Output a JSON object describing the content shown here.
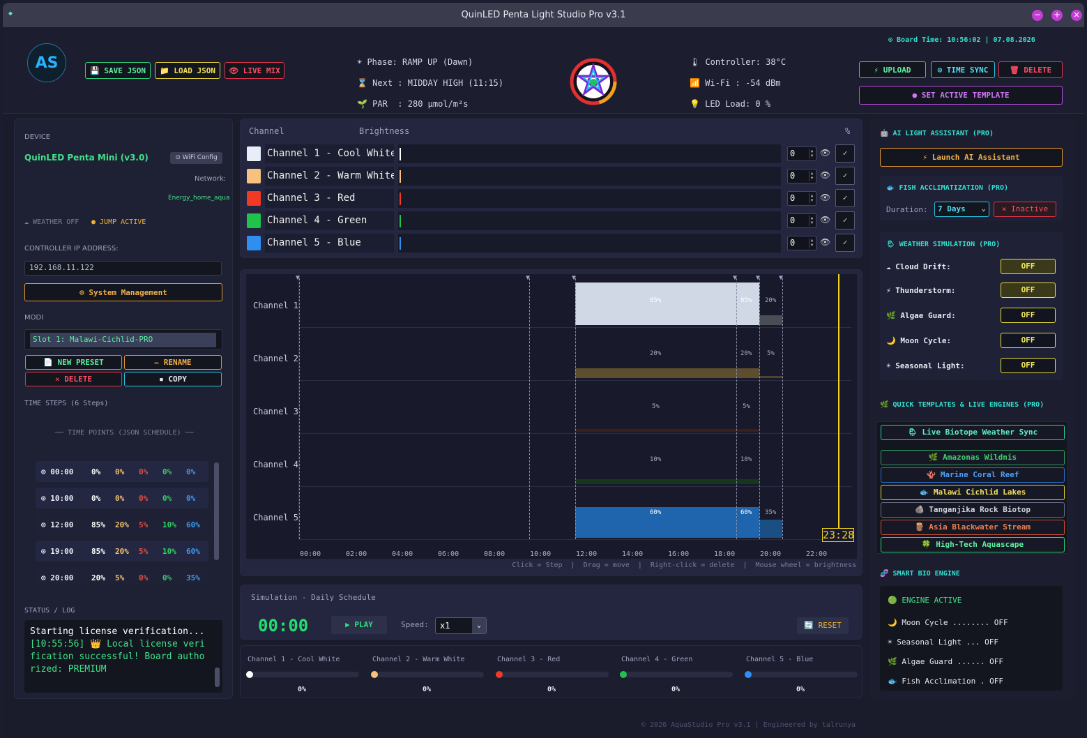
{
  "window": {
    "title": "QuinLED Penta Light Studio Pro v3.1"
  },
  "header": {
    "board_time": "⊙ Board Time: 10:56:02 | 07.08.2026",
    "logo": "AS",
    "save_json": "💾 SAVE JSON",
    "load_json": "📁 LOAD JSON",
    "live_mix": "👁 LIVE MIX",
    "phase": "☀ Phase: RAMP UP (Dawn)",
    "next": "⌛ Next : MIDDAY HIGH (11:15)",
    "par": "🌱 PAR  : 280 μmol/m²s",
    "controller": "🌡 Controller: 38°C",
    "wifi": "📶 Wi-Fi : -54 dBm",
    "led_load": "💡 LED Load: 0 %",
    "upload": "⚡ UPLOAD",
    "time_sync": "⊙ TIME SYNC",
    "delete": "🗑 DELETE",
    "set_active_template": "● SET ACTIVE TEMPLATE"
  },
  "left": {
    "device_label": "DEVICE",
    "device_name": "QuinLED Penta Mini (v3.0)",
    "wifi_config": "⊙ WiFi Config",
    "network_label": "Network:",
    "network_name": "Energy_home_aqua",
    "weather_off": "☁ WEATHER OFF",
    "jump_active": "● JUMP ACTIVE",
    "ip_label": "CONTROLLER IP ADDRESS:",
    "ip_value": "192.168.11.122",
    "system_management": "⊙ System Management",
    "modi_label": "MODI",
    "slot": "Slot 1: Malawi-Cichlid-PRO",
    "new_preset": "📄 NEW PRESET",
    "rename": "✏ RENAME",
    "delete": "✕ DELETE",
    "copy": "▪ COPY",
    "time_steps": "TIME STEPS (6 Steps)",
    "time_points_title": "── TIME POINTS (JSON SCHEDULE) ──",
    "time_points": [
      {
        "t": "⊙ 00:00",
        "v": [
          "0%",
          "0%",
          "0%",
          "0%",
          "0%"
        ]
      },
      {
        "t": "⊙ 10:00",
        "v": [
          "0%",
          "0%",
          "0%",
          "0%",
          "0%"
        ]
      },
      {
        "t": "⊙ 12:00",
        "v": [
          "85%",
          "20%",
          "5%",
          "10%",
          "60%"
        ]
      },
      {
        "t": "⊙ 19:00",
        "v": [
          "85%",
          "20%",
          "5%",
          "10%",
          "60%"
        ]
      },
      {
        "t": "⊙ 20:00",
        "v": [
          "20%",
          "5%",
          "0%",
          "0%",
          "35%"
        ]
      }
    ],
    "status_label": "STATUS / LOG",
    "log1": "Starting license verification...",
    "log2": "[10:55:56] 👑 Local license verification successful! Board authorized: PREMIUM"
  },
  "channels": {
    "col_channel": "Channel",
    "col_brightness": "Brightness",
    "col_pct": "%",
    "rows": [
      {
        "name": "Channel 1 - Cool White",
        "value": "0",
        "color": "#e8eef8"
      },
      {
        "name": "Channel 2 - Warm White",
        "value": "0",
        "color": "#f7c27e"
      },
      {
        "name": "Channel 3 - Red",
        "value": "0",
        "color": "#f03a25"
      },
      {
        "name": "Channel 4 - Green",
        "value": "0",
        "color": "#1fc24a"
      },
      {
        "name": "Channel 5 - Blue",
        "value": "0",
        "color": "#2e8ff0"
      }
    ]
  },
  "graph": {
    "labels": [
      "Channel 1",
      "Channel 2",
      "Channel 3",
      "Channel 4",
      "Channel 5"
    ],
    "ticks": [
      "00:00",
      "02:00",
      "04:00",
      "06:00",
      "08:00",
      "10:00",
      "12:00",
      "14:00",
      "16:00",
      "18:00",
      "20:00",
      "22:00"
    ],
    "now": "23:28",
    "hint": "Click = Step  |  Drag = move  |  Right-click = delete  |  Mouse wheel = brightness",
    "pct": [
      [
        "85%",
        "85%",
        "20%"
      ],
      [
        "20%",
        "20%",
        "5%"
      ],
      [
        "5%",
        "5%",
        ""
      ],
      [
        "10%",
        "10%",
        ""
      ],
      [
        "60%",
        "60%",
        "35%"
      ]
    ]
  },
  "sim": {
    "title": "Simulation - Daily Schedule",
    "clock": "00:00",
    "play": "▶ PLAY",
    "speed_label": "Speed:",
    "speed": "x1",
    "reset": "🔄 RESET"
  },
  "bottom": [
    {
      "name": "Channel 1 - Cool White",
      "pct": "0%",
      "color": "#ffffff"
    },
    {
      "name": "Channel 2 - Warm White",
      "pct": "0%",
      "color": "#f7c27e"
    },
    {
      "name": "Channel 3 - Red",
      "pct": "0%",
      "color": "#f03a25"
    },
    {
      "name": "Channel 4 - Green",
      "pct": "0%",
      "color": "#1fc24a"
    },
    {
      "name": "Channel 5 - Blue",
      "pct": "0%",
      "color": "#2e8ff0"
    }
  ],
  "right": {
    "ai_title": "🤖 AI LIGHT ASSISTANT (PRO)",
    "ai_launch": "⚡ Launch AI Assistant",
    "fish_title": "🐟 FISH ACCLIMATIZATION (PRO)",
    "duration_label": "Duration:",
    "duration": "7 Days",
    "inactive": "✕ Inactive",
    "weather_title": "🌦 WEATHER SIMULATION (PRO)",
    "cloud": "☁ Cloud Drift:",
    "thunder": "⚡ Thunderstorm:",
    "algae": "🌿 Algae Guard:",
    "moon": "🌙 Moon Cycle:",
    "seasonal": "☀ Seasonal Light:",
    "off": "OFF",
    "templates_title": "🌿 QUICK TEMPLATES & LIVE ENGINES (PRO)",
    "templates": [
      "🌦 Live Biotope Weather Sync",
      "🌿 Amazonas Wildnis",
      "🪸 Marine Coral Reef",
      "🐟 Malawi Cichlid Lakes",
      "🪨 Tanganjika Rock Biotop",
      "🪵 Asia Blackwater Stream",
      "🍀 High-Tech Aquascape"
    ],
    "bio_title": "🧬 SMART BIO ENGINE",
    "bio": [
      "🟢 ENGINE ACTIVE",
      "🌙 Moon Cycle ........ OFF",
      "☀ Seasonal Light ... OFF",
      "🌿 Algae Guard ...... OFF",
      "🐟 Fish Acclimation . OFF"
    ]
  },
  "footer": "© 2026 AquaStudio Pro v3.1 | Engineered by talrunya"
}
